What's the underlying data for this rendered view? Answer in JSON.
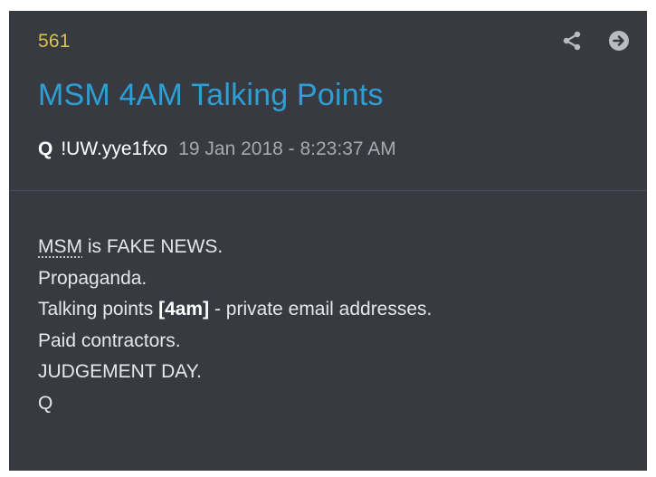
{
  "post": {
    "number": "561",
    "title": "MSM 4AM Talking Points",
    "author": "Q",
    "tripcode": "!UW.yye1fxo",
    "timestamp": "19 Jan 2018 - 8:23:37 AM"
  },
  "icons": {
    "share": "share-icon",
    "open": "arrow-right-circle-icon"
  },
  "body": {
    "line1_abbr": "MSM",
    "line1_rest": " is FAKE NEWS.",
    "line2": "Propaganda.",
    "line3_pre": "Talking points ",
    "line3_bracket": "[4am]",
    "line3_post": " - private email addresses.",
    "line4": "Paid contractors.",
    "line5": "JUDGEMENT DAY.",
    "line6": "Q"
  },
  "colors": {
    "background": "#373a41",
    "post_number": "#d9c24a",
    "title": "#2e9fd4",
    "timestamp": "#a7aab1"
  }
}
